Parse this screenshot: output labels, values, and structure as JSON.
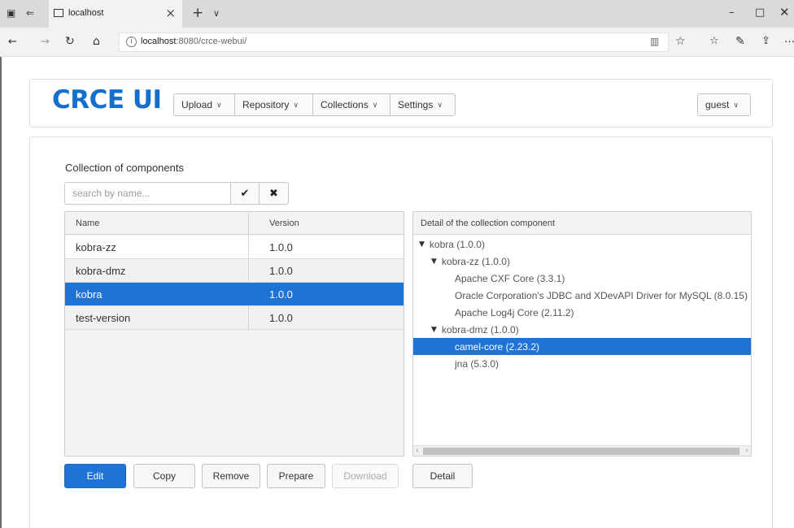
{
  "browser": {
    "tab_title": "localhost",
    "new_tab_label": "+",
    "url_host": "localhost",
    "url_rest": ":8080/crce-webui/"
  },
  "app": {
    "brand": "CRCE UI",
    "menus": [
      {
        "label": "Upload"
      },
      {
        "label": "Repository"
      },
      {
        "label": "Collections"
      },
      {
        "label": "Settings"
      }
    ],
    "user_label": "guest"
  },
  "collection": {
    "title": "Collection of components",
    "search_placeholder": "search by name...",
    "columns": [
      "Name",
      "Version"
    ],
    "rows": [
      {
        "name": "kobra-zz",
        "version": "1.0.0",
        "selected": false
      },
      {
        "name": "kobra-dmz",
        "version": "1.0.0",
        "selected": false
      },
      {
        "name": "kobra",
        "version": "1.0.0",
        "selected": true
      },
      {
        "name": "test-version",
        "version": "1.0.0",
        "selected": false
      }
    ]
  },
  "detail": {
    "header": "Detail of the collection component",
    "tree": [
      {
        "label": "kobra (1.0.0)",
        "level": 0,
        "expanded": true,
        "selected": false
      },
      {
        "label": "kobra-zz (1.0.0)",
        "level": 1,
        "expanded": true,
        "selected": false
      },
      {
        "label": "Apache CXF Core (3.3.1)",
        "level": 2,
        "expanded": false,
        "selected": false
      },
      {
        "label": "Oracle Corporation's JDBC and XDevAPI Driver for MySQL (8.0.15)",
        "level": 2,
        "expanded": false,
        "selected": false
      },
      {
        "label": "Apache Log4j Core (2.11.2)",
        "level": 2,
        "expanded": false,
        "selected": false
      },
      {
        "label": "kobra-dmz (1.0.0)",
        "level": 1,
        "expanded": true,
        "selected": false
      },
      {
        "label": "camel-core (2.23.2)",
        "level": 2,
        "expanded": false,
        "selected": true
      },
      {
        "label": "jna (5.3.0)",
        "level": 2,
        "expanded": false,
        "selected": false
      }
    ]
  },
  "actions": {
    "edit": "Edit",
    "copy": "Copy",
    "remove": "Remove",
    "prepare": "Prepare",
    "download": "Download",
    "detail": "Detail"
  },
  "colors": {
    "brand": "#1470cc",
    "selection": "#1f73d6"
  }
}
